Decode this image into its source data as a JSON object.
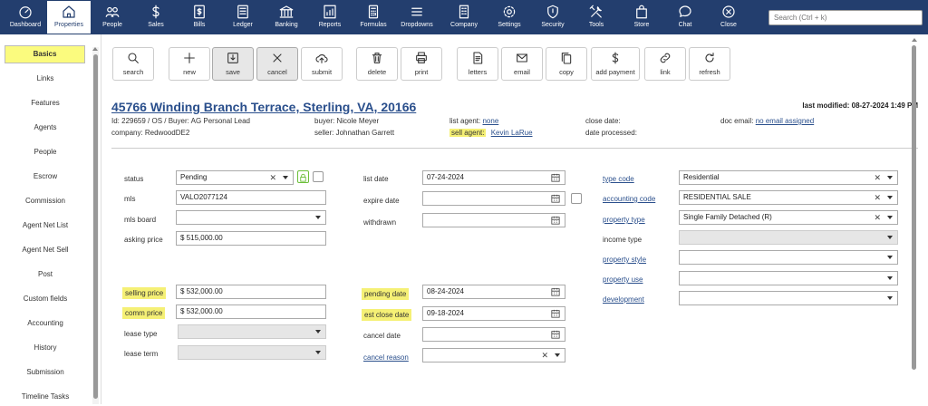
{
  "nav": {
    "items": [
      {
        "label": "Dashboard",
        "icon": "dashboard-icon"
      },
      {
        "label": "Properties",
        "icon": "home-icon"
      },
      {
        "label": "People",
        "icon": "people-icon"
      },
      {
        "label": "Sales",
        "icon": "dollar-icon"
      },
      {
        "label": "Bills",
        "icon": "bills-icon"
      },
      {
        "label": "Ledger",
        "icon": "ledger-icon"
      },
      {
        "label": "Banking",
        "icon": "bank-icon"
      },
      {
        "label": "Reports",
        "icon": "reports-icon"
      },
      {
        "label": "Formulas",
        "icon": "calculator-icon"
      },
      {
        "label": "Dropdowns",
        "icon": "menu-icon"
      },
      {
        "label": "Company",
        "icon": "building-icon"
      },
      {
        "label": "Settings",
        "icon": "gear-icon"
      },
      {
        "label": "Security",
        "icon": "shield-icon"
      },
      {
        "label": "Tools",
        "icon": "tools-icon"
      },
      {
        "label": "Store",
        "icon": "bag-icon"
      },
      {
        "label": "Chat",
        "icon": "chat-icon"
      },
      {
        "label": "Close",
        "icon": "close-circle-icon"
      }
    ],
    "active": "Properties",
    "search_placeholder": "Search (Ctrl + k)"
  },
  "sidebar": {
    "items": [
      "Basics",
      "Links",
      "Features",
      "Agents",
      "People",
      "Escrow",
      "Commission",
      "Agent Net List",
      "Agent Net Sell",
      "Post",
      "Custom fields",
      "Accounting",
      "History",
      "Submission",
      "Timeline Tasks"
    ],
    "active": "Basics"
  },
  "toolbar": {
    "buttons": [
      {
        "label": "search",
        "icon": "search-icon"
      },
      {
        "label": "new",
        "icon": "plus-icon"
      },
      {
        "label": "save",
        "icon": "save-icon"
      },
      {
        "label": "cancel",
        "icon": "x-icon"
      },
      {
        "label": "submit",
        "icon": "upload-cloud-icon"
      },
      {
        "label": "delete",
        "icon": "trash-icon"
      },
      {
        "label": "print",
        "icon": "printer-icon"
      },
      {
        "label": "letters",
        "icon": "document-icon"
      },
      {
        "label": "email",
        "icon": "envelope-icon"
      },
      {
        "label": "copy",
        "icon": "copy-icon"
      },
      {
        "label": "add payment",
        "icon": "dollar-icon"
      },
      {
        "label": "link",
        "icon": "link-icon"
      },
      {
        "label": "refresh",
        "icon": "refresh-icon"
      }
    ]
  },
  "header": {
    "address": "45766 Winding Branch Terrace, Sterling, VA, 20166",
    "last_modified": "last modified: 08-27-2024 1:49 PM",
    "id_line": "Id: 229659 / OS / Buyer: AG Personal Lead",
    "company": "company: RedwoodDE2",
    "buyer": "buyer: Nicole Meyer",
    "seller": "seller: Johnathan Garrett",
    "list_agent_label": "list agent:",
    "list_agent_value": "none",
    "sell_agent_label": "sell agent:",
    "sell_agent_value": "Kevin LaRue",
    "close_date": "close date:",
    "date_processed": "date processed:",
    "doc_email_label": "doc email:",
    "doc_email_value": "no email assigned"
  },
  "form": {
    "status": {
      "label": "status",
      "value": "Pending"
    },
    "mls": {
      "label": "mls",
      "value": "VALO2077124"
    },
    "mls_board": {
      "label": "mls board",
      "value": ""
    },
    "asking_price": {
      "label": "asking price",
      "value": "$ 515,000.00"
    },
    "selling_price": {
      "label": "selling price",
      "value": "$ 532,000.00"
    },
    "comm_price": {
      "label": "comm price",
      "value": "$ 532,000.00"
    },
    "lease_type": {
      "label": "lease type",
      "value": ""
    },
    "lease_term": {
      "label": "lease term",
      "value": ""
    },
    "list_date": {
      "label": "list date",
      "value": "07-24-2024"
    },
    "expire_date": {
      "label": "expire date",
      "value": ""
    },
    "withdrawn": {
      "label": "withdrawn",
      "value": ""
    },
    "pending_date": {
      "label": "pending date",
      "value": "08-24-2024"
    },
    "est_close_date": {
      "label": "est close date",
      "value": "09-18-2024"
    },
    "cancel_date": {
      "label": "cancel date",
      "value": ""
    },
    "cancel_reason": {
      "label": "cancel reason",
      "value": ""
    },
    "type_code": {
      "label": "type code",
      "value": "Residential"
    },
    "accounting_code": {
      "label": "accounting code",
      "value": "RESIDENTIAL SALE"
    },
    "property_type": {
      "label": "property type",
      "value": "Single Family Detached (R)"
    },
    "income_type": {
      "label": "income type",
      "value": ""
    },
    "property_style": {
      "label": "property style",
      "value": ""
    },
    "property_use": {
      "label": "property use",
      "value": ""
    },
    "development": {
      "label": "development",
      "value": ""
    }
  },
  "colors": {
    "nav_bg": "#233e6e",
    "highlight": "#f5f075",
    "link": "#2a4f8c"
  }
}
